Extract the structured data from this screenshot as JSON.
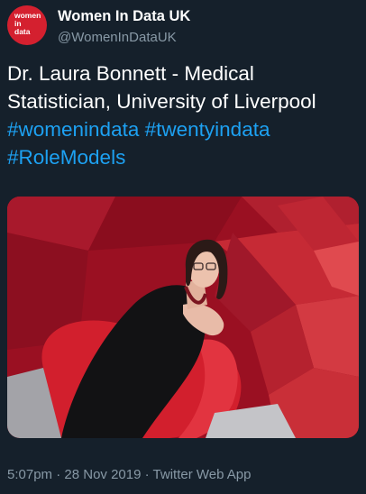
{
  "author": {
    "display_name": "Women In Data UK",
    "handle": "@WomenInDataUK",
    "avatar_text": "women\nin\ndata",
    "avatar_color": "#d4202f"
  },
  "tweet": {
    "text_plain": "Dr. Laura Bonnett - Medical Statistician, University of Liverpool",
    "hashtags": [
      "#womenindata",
      "#twentyindata",
      "#RoleModels"
    ]
  },
  "meta": {
    "time": "5:07pm",
    "date": "28 Nov 2019",
    "source": "Twitter Web App",
    "separator": "·"
  },
  "colors": {
    "background": "#15202b",
    "text": "#ffffff",
    "muted": "#8899a6",
    "link": "#1da1f2"
  }
}
